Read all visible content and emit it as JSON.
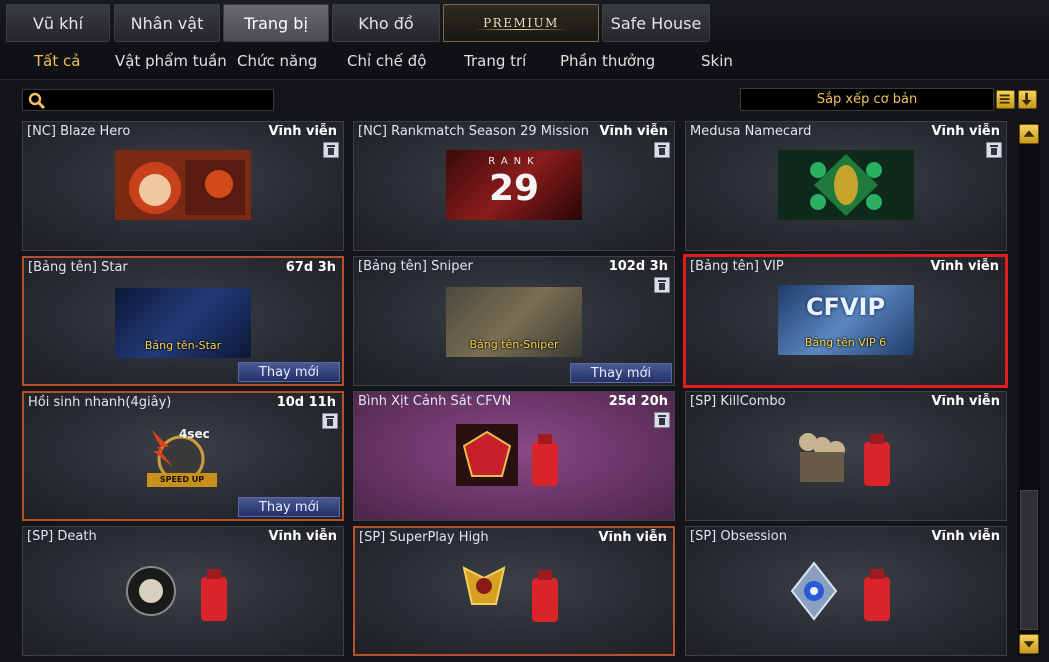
{
  "top_tabs": [
    {
      "label": "Vũ khí"
    },
    {
      "label": "Nhân vật"
    },
    {
      "label": "Trang bị"
    },
    {
      "label": "Kho đồ"
    },
    {
      "label": "PREMIUM"
    },
    {
      "label": "Safe House"
    }
  ],
  "active_top_tab": "Trang bị",
  "sub_tabs": [
    {
      "label": "Tất cả"
    },
    {
      "label": "Vật phẩm tuần"
    },
    {
      "label": "Chức năng"
    },
    {
      "label": "Chỉ chế độ"
    },
    {
      "label": "Trang trí"
    },
    {
      "label": "Phần thưởng"
    },
    {
      "label": "Skin"
    }
  ],
  "active_sub_tab": "Tất cả",
  "search": {
    "value": "",
    "icon": "magnifier-icon"
  },
  "sort": {
    "label": "Sắp xếp cơ bản",
    "list_icon": "list-icon",
    "direction_icon": "arrow-down-icon"
  },
  "items": [
    {
      "name": "[NC] Blaze Hero",
      "duration": "Vĩnh viễn",
      "trash": true,
      "replace": ""
    },
    {
      "name": "[NC] Rankmatch Season 29 Mission",
      "duration": "Vĩnh viễn",
      "trash": true,
      "replace": "",
      "thumb_text": "29",
      "thumb_sub": "RANK"
    },
    {
      "name": "Medusa Namecard",
      "duration": "Vĩnh viễn",
      "trash": true,
      "replace": ""
    },
    {
      "name": "[Bảng tên] Star",
      "duration": "67d 3h",
      "trash": false,
      "replace": "Thay mới",
      "thumb_text": "Bảng tên-Star"
    },
    {
      "name": "[Bảng tên] Sniper",
      "duration": "102d 3h",
      "trash": true,
      "replace": "Thay mới",
      "thumb_text": "Bảng tên-Sniper"
    },
    {
      "name": "[Bảng tên] VIP",
      "duration": "Vĩnh viễn",
      "trash": false,
      "replace": "",
      "thumb_text": "Bảng tên VIP 6",
      "thumb_sub": "CFVIP"
    },
    {
      "name": "Hồi sinh nhanh(4giây)",
      "duration": "10d 11h",
      "trash": true,
      "replace": "Thay mới",
      "thumb_text": "SPEED UP",
      "thumb_sub": "4sec"
    },
    {
      "name": "Bình Xịt Cảnh Sát CFVN",
      "duration": "25d 20h",
      "trash": true,
      "replace": ""
    },
    {
      "name": "[SP] KillCombo",
      "duration": "Vĩnh viễn",
      "trash": false,
      "replace": ""
    },
    {
      "name": "[SP] Death",
      "duration": "Vĩnh viễn",
      "trash": false,
      "replace": ""
    },
    {
      "name": "[SP] SuperPlay High",
      "duration": "Vĩnh viễn",
      "trash": false,
      "replace": ""
    },
    {
      "name": "[SP] Obsession",
      "duration": "Vĩnh viễn",
      "trash": false,
      "replace": ""
    }
  ],
  "colors": {
    "accent": "#f2c15b",
    "highlight_red": "#e11e1e",
    "orange_border": "#b3512c",
    "button_blue": "#34407c"
  }
}
